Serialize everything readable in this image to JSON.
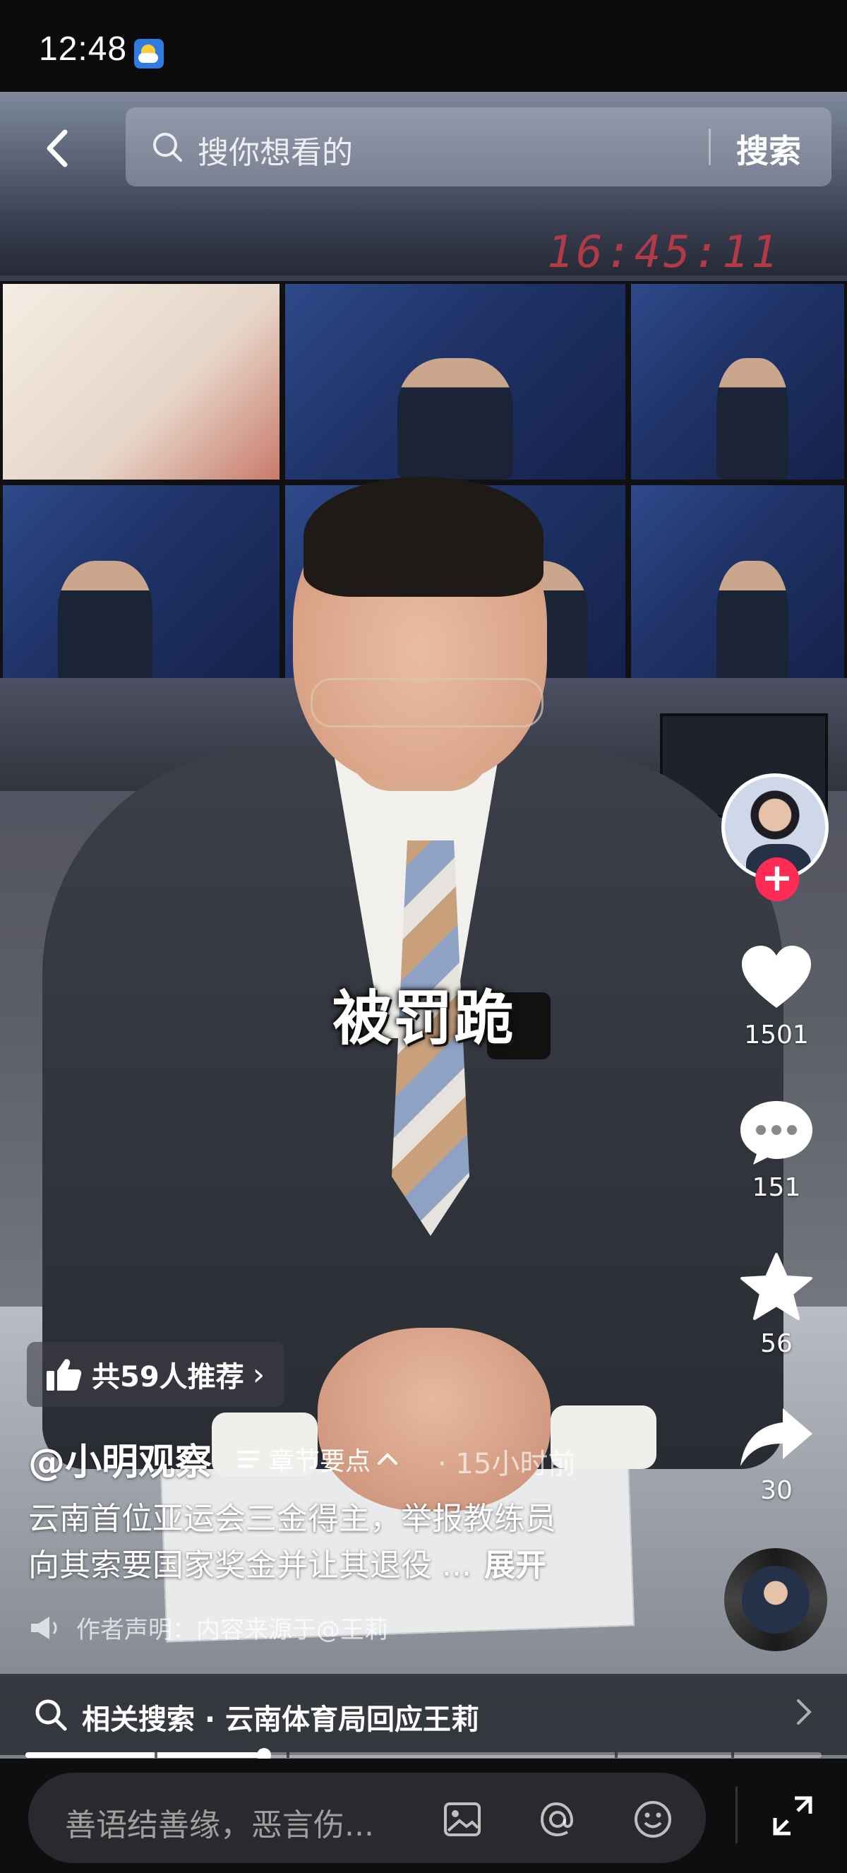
{
  "status_bar": {
    "time": "12:48",
    "weather_icon": "weather-sun-cloud-icon"
  },
  "top_bar": {
    "back_icon": "back-arrow-icon",
    "search_placeholder": "搜你想看的",
    "search_button": "搜索"
  },
  "video": {
    "caption": "被罚跪",
    "studio_clock": "16:45:11"
  },
  "right_rail": {
    "follow_icon": "plus-icon",
    "like_count": "1501",
    "comment_count": "151",
    "favorite_count": "56",
    "share_count": "30",
    "icons": [
      "heart-icon",
      "comment-bubble-icon",
      "star-icon",
      "share-arrow-icon",
      "music-disc-icon"
    ]
  },
  "overlay": {
    "recommend_label": "共59人推荐",
    "recommend_chevron": "›",
    "author": "@小明观察",
    "chapters_label": "章节要点",
    "time_ago": "· 15小时前",
    "description_line1": "云南首位亚运会三金得主，举报教练员",
    "description_line2": "向其索要国家奖金并让其退役 ...",
    "expand_label": "展开",
    "disclaimer": "作者声明：内容来源于@王莉"
  },
  "related": {
    "label": "相关搜索 · 云南体育局回应王莉"
  },
  "progress": {
    "fraction": 0.3
  },
  "comment_bar": {
    "placeholder": "善语结善缘，恶言伤...",
    "icons": [
      "image-icon",
      "at-icon",
      "emoji-icon",
      "fullscreen-icon"
    ]
  },
  "colors": {
    "follow_accent": "#fe2c55",
    "studio_clock": "#c23a4a"
  }
}
